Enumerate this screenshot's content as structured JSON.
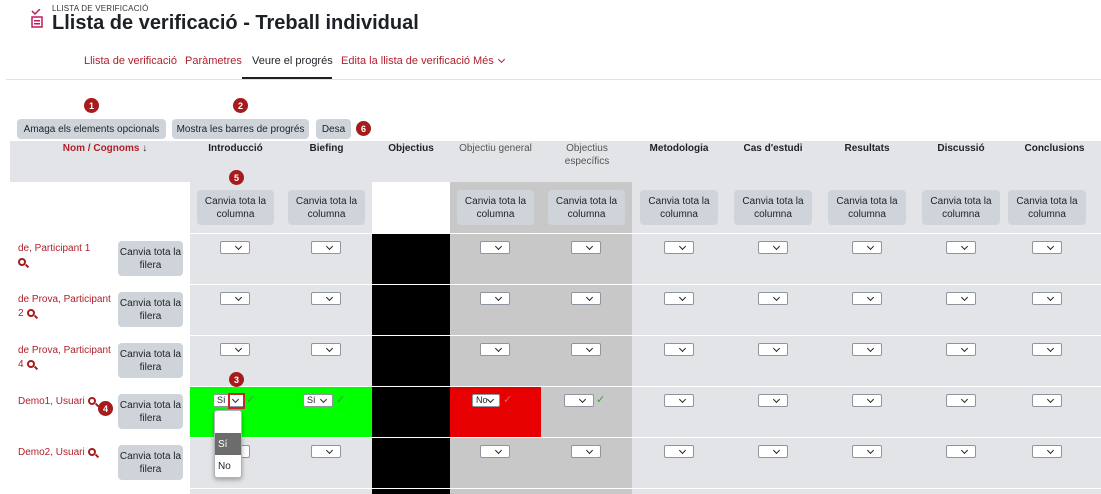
{
  "page": {
    "breadcrumb": "LLISTA DE VERIFICACIÓ",
    "title": "Llista de verificació - Treball individual"
  },
  "tabs": [
    {
      "label": "Llista de verificació"
    },
    {
      "label": "Paràmetres"
    },
    {
      "label": "Veure el progrés"
    },
    {
      "label": "Edita la llista de verificació"
    },
    {
      "label": "Més"
    }
  ],
  "toolbar": {
    "hide_optional": "Amaga els elements opcionals",
    "show_bars": "Mostra les barres de progrés",
    "save": "Desa"
  },
  "badges": {
    "b1": "1",
    "b2": "2",
    "b3": "3",
    "b4": "4",
    "b5": "5",
    "b6": "6"
  },
  "table": {
    "sort_first": "Nom",
    "sort_sep": " / ",
    "sort_last": "Cognoms",
    "sort_arrow": "↓",
    "columns": [
      {
        "label": "Introducció"
      },
      {
        "label": "Biefing"
      },
      {
        "label": "Objectius"
      },
      {
        "label": "Objectiu general"
      },
      {
        "label": "Objectius específics"
      },
      {
        "label": "Metodologia"
      },
      {
        "label": "Cas d'estudi"
      },
      {
        "label": "Resultats"
      },
      {
        "label": "Discussió"
      },
      {
        "label": "Conclusions"
      }
    ],
    "toggle_column": "Canvia tota la columna",
    "toggle_row": "Canvia tota la filera",
    "rows": [
      {
        "name": "de, Participant 1"
      },
      {
        "name": "de Prova, Participant 2"
      },
      {
        "name": "de Prova, Participant 4"
      },
      {
        "name": "Demo1, Usuari"
      },
      {
        "name": "Demo2, Usuari"
      }
    ],
    "values": {
      "yes": "Sí",
      "no": "No"
    }
  },
  "dropdown": {
    "options": [
      "",
      "Sí",
      "No"
    ]
  },
  "colors": {
    "accent": "#b0202c",
    "yes": "#00ff00",
    "no": "#e60000",
    "badge": "#a61b1b"
  }
}
